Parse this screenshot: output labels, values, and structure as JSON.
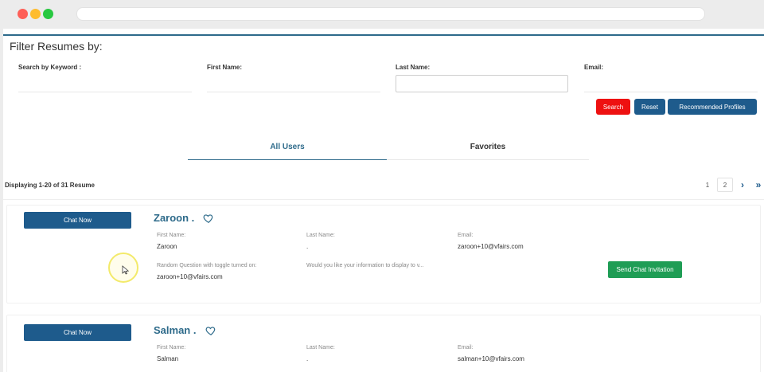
{
  "filter": {
    "title": "Filter Resumes by:",
    "keyword_label": "Search by Keyword :",
    "first_name_label": "First Name:",
    "last_name_label": "Last Name:",
    "email_label": "Email:",
    "keyword_value": "",
    "first_name_value": "",
    "last_name_value": "",
    "email_value": ""
  },
  "buttons": {
    "search": "Search",
    "reset": "Reset",
    "recommended": "Recommended Profiles"
  },
  "colors": {
    "accent": "#1e5b8c",
    "search": "#ee1111",
    "invite": "#1f9d55"
  },
  "tabs": [
    {
      "label": "All Users",
      "active": true
    },
    {
      "label": "Favorites",
      "active": false
    }
  ],
  "results": {
    "displaying": "Displaying 1-20 of 31 Resume"
  },
  "pagination": {
    "pages": [
      "1",
      "2"
    ],
    "next": "›",
    "last": "»"
  },
  "candidates": [
    {
      "chat_label": "Chat Now",
      "name": "Zaroon .",
      "first_name_label": "First Name:",
      "first_name": "Zaroon",
      "last_name_label": "Last Name:",
      "last_name": ".",
      "email_label": "Email:",
      "email": "zaroon+10@vfairs.com",
      "question_label": "Random Question with toggle turned on:",
      "question_value": "zaroon+10@vfairs.com",
      "question2_label": "Would you like your information to display to v...",
      "invite_label": "Send Chat Invitation"
    },
    {
      "chat_label": "Chat Now",
      "name": "Salman .",
      "first_name_label": "First Name:",
      "first_name": "Salman",
      "last_name_label": "Last Name:",
      "last_name": ".",
      "email_label": "Email:",
      "email": "salman+10@vfairs.com"
    }
  ]
}
